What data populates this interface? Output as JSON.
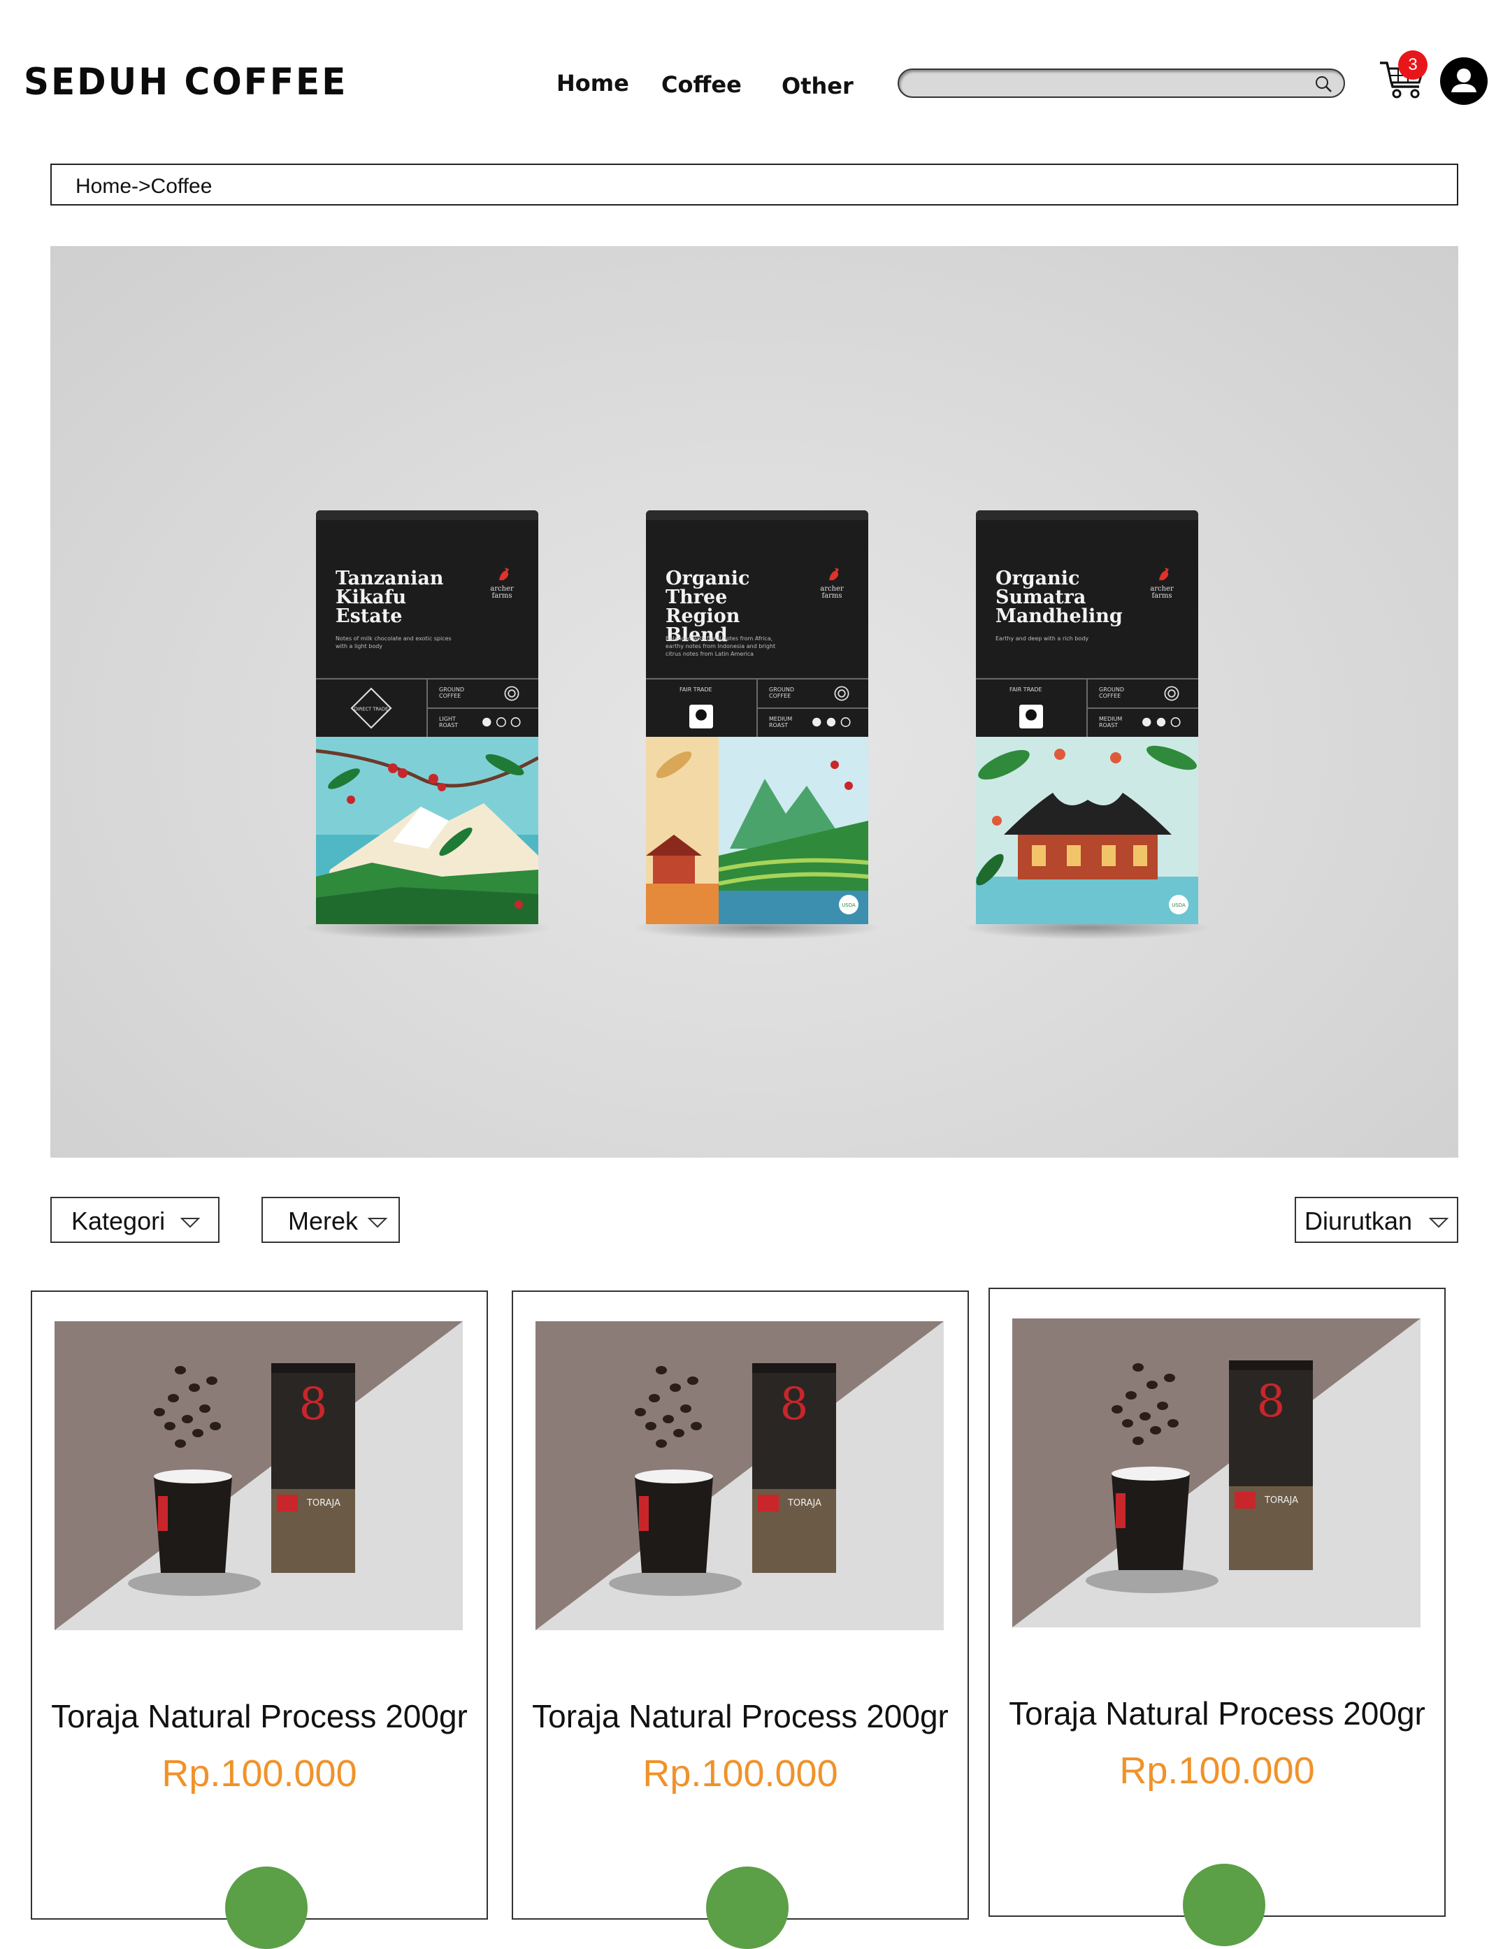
{
  "header": {
    "logo": "SEDUH COFFEE",
    "nav": [
      {
        "label": "Home"
      },
      {
        "label": "Coffee"
      },
      {
        "label": "Other"
      }
    ],
    "search_placeholder": "",
    "search_icon": "search-icon",
    "cart_icon": "cart-icon",
    "cart_count": "3",
    "profile_icon": "user-icon"
  },
  "breadcrumb": "Home->Coffee",
  "hero": {
    "bags": [
      {
        "name_lines": [
          "Tanzanian",
          "Kikafu",
          "Estate"
        ],
        "brand": "archer farms",
        "description": "Notes of milk chocolate and exotic spices with a light body",
        "grind": "GROUND COFFEE",
        "roast": "LIGHT ROAST",
        "badge": "DIRECT TRADE",
        "roast_level": 1,
        "roast_max": 3
      },
      {
        "name_lines": [
          "Organic",
          "Three Region",
          "Blend"
        ],
        "brand": "archer farms",
        "description": "Balanced with floral notes from Africa, earthy notes from Indonesia and bright citrus notes from Latin America",
        "grind": "GROUND COFFEE",
        "roast": "MEDIUM ROAST",
        "badge": "FAIR TRADE",
        "roast_level": 2,
        "roast_max": 3
      },
      {
        "name_lines": [
          "Organic",
          "Sumatra",
          "Mandheling"
        ],
        "brand": "archer farms",
        "description": "Earthy and deep with a rich body",
        "grind": "GROUND COFFEE",
        "roast": "MEDIUM ROAST",
        "badge": "FAIR TRADE",
        "roast_level": 2,
        "roast_max": 3
      }
    ]
  },
  "filters": {
    "category": "Kategori",
    "brand": "Merek",
    "sort": "Diurutkan"
  },
  "products": [
    {
      "title": "Toraja Natural Process 200gr",
      "price": "Rp.100.000",
      "pack_label": "TORAJA",
      "pack_number": "8"
    },
    {
      "title": "Toraja Natural Process 200gr",
      "price": "Rp.100.000",
      "pack_label": "TORAJA",
      "pack_number": "8"
    },
    {
      "title": "Toraja Natural Process 200gr",
      "price": "Rp.100.000",
      "pack_label": "TORAJA",
      "pack_number": "8"
    }
  ],
  "colors": {
    "price": "#f0922a",
    "badge": "#e8161b",
    "add_button": "#5b9f47"
  }
}
